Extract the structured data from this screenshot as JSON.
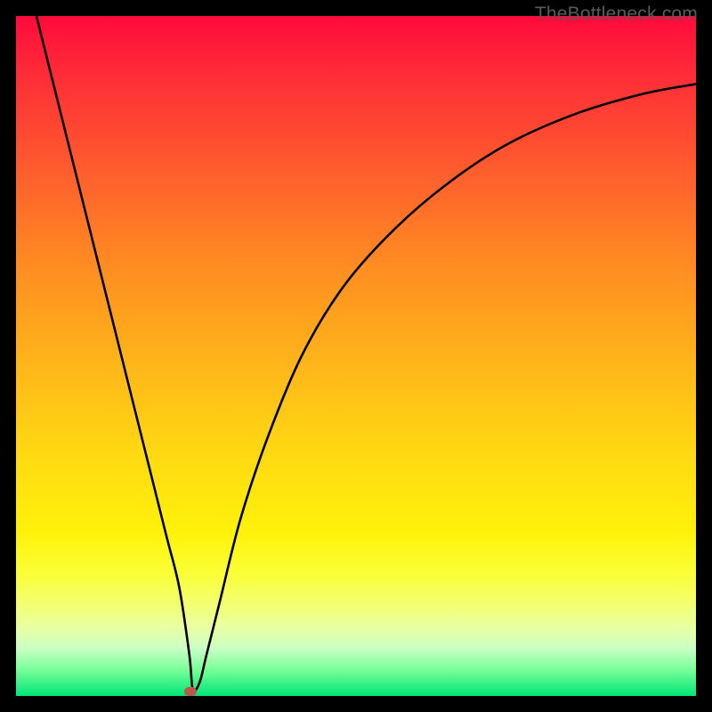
{
  "watermark": "TheBottleneck.com",
  "chart_data": {
    "type": "line",
    "title": "",
    "xlabel": "",
    "ylabel": "",
    "xlim": [
      0,
      100
    ],
    "ylim": [
      0,
      100
    ],
    "grid": false,
    "legend": false,
    "series": [
      {
        "name": "bottleneck-curve",
        "x": [
          3,
          6,
          10,
          14,
          18,
          22,
          24,
          25.5,
          26,
          27,
          28,
          30,
          33,
          37,
          42,
          48,
          55,
          63,
          72,
          82,
          92,
          100
        ],
        "y": [
          100,
          88,
          72,
          56,
          40,
          24,
          16,
          6,
          1,
          2,
          6,
          14,
          26,
          38,
          50,
          60,
          68,
          75,
          81,
          85.5,
          88.5,
          90
        ],
        "color": "#000000"
      }
    ],
    "marker": {
      "name": "optimal-point",
      "x": 25.7,
      "y": 0.6,
      "color": "#c0554a"
    },
    "gradient_stops": [
      {
        "pos": 0.0,
        "color": "#ff0a3b"
      },
      {
        "pos": 0.08,
        "color": "#ff2a38"
      },
      {
        "pos": 0.22,
        "color": "#ff5a2e"
      },
      {
        "pos": 0.36,
        "color": "#ff8a22"
      },
      {
        "pos": 0.5,
        "color": "#ffb21a"
      },
      {
        "pos": 0.64,
        "color": "#ffd812"
      },
      {
        "pos": 0.76,
        "color": "#fff20a"
      },
      {
        "pos": 0.82,
        "color": "#faff36"
      },
      {
        "pos": 0.86,
        "color": "#f4ff6a"
      },
      {
        "pos": 0.9,
        "color": "#e8ffa4"
      },
      {
        "pos": 0.93,
        "color": "#caffc4"
      },
      {
        "pos": 0.96,
        "color": "#7cff9a"
      },
      {
        "pos": 1.0,
        "color": "#00e676"
      }
    ]
  }
}
